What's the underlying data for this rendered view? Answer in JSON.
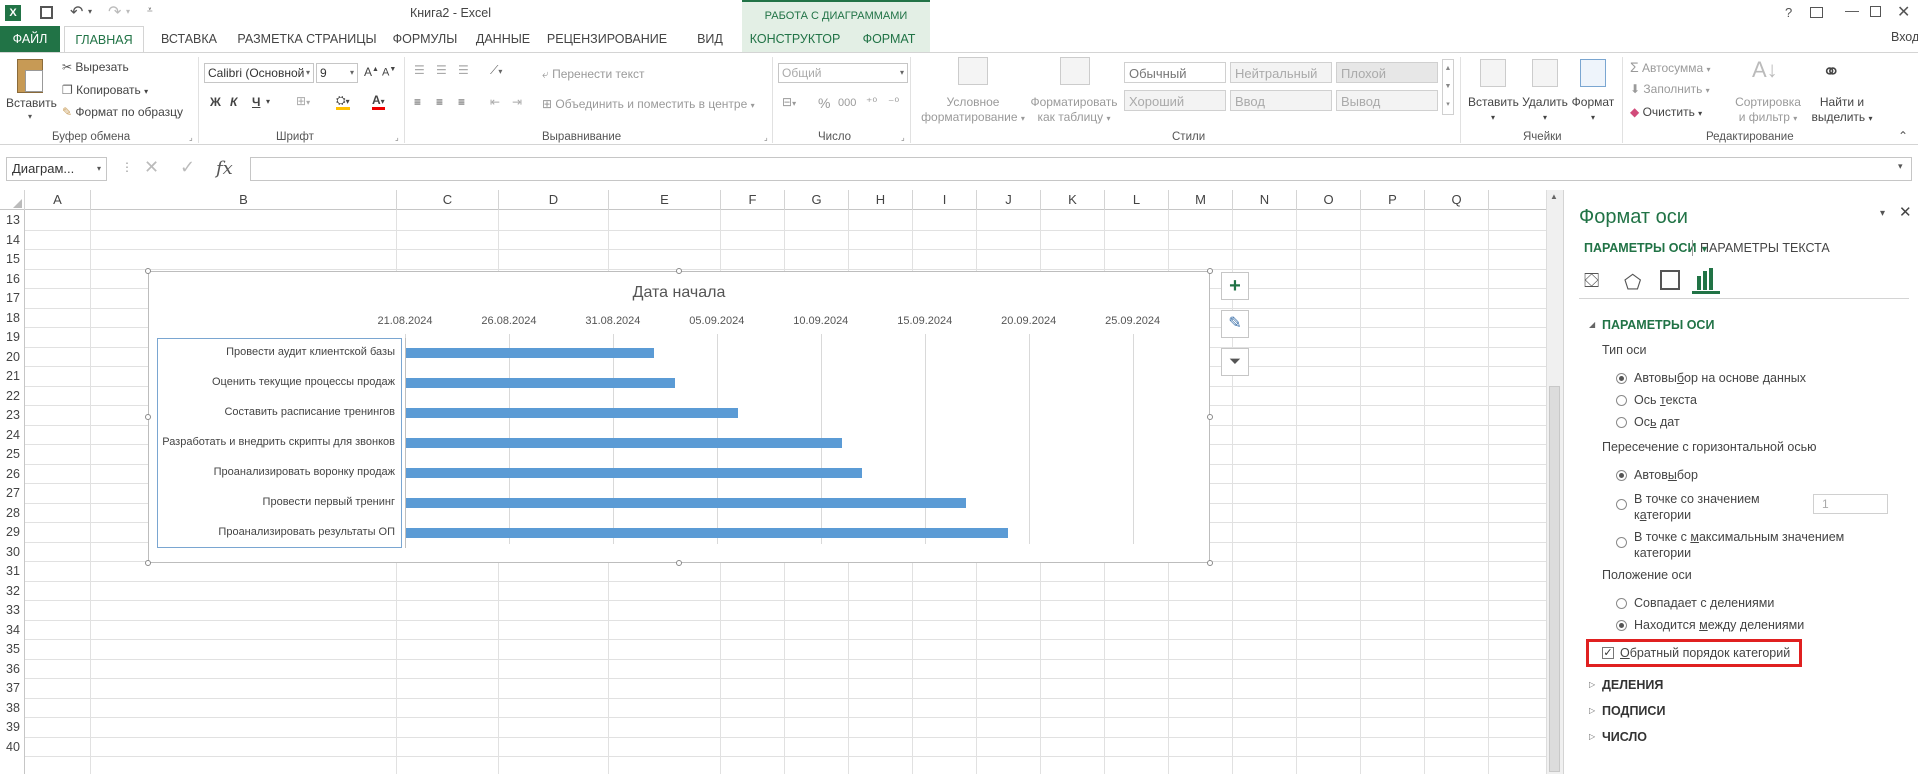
{
  "window": {
    "title": "Книга2 - Excel",
    "context_group": "РАБОТА С ДИАГРАММАМИ",
    "help": "?",
    "signin": "Вход"
  },
  "tabs": [
    "ФАЙЛ",
    "ГЛАВНАЯ",
    "ВСТАВКА",
    "РАЗМЕТКА СТРАНИЦЫ",
    "ФОРМУЛЫ",
    "ДАННЫЕ",
    "РЕЦЕНЗИРОВАНИЕ",
    "ВИД",
    "КОНСТРУКТОР",
    "ФОРМАТ"
  ],
  "ribbon": {
    "clipboard": {
      "label": "Буфер обмена",
      "paste": "Вставить",
      "cut": "Вырезать",
      "copy": "Копировать",
      "format_painter": "Формат по образцу"
    },
    "font": {
      "label": "Шрифт",
      "name": "Calibri (Основной",
      "size": "9",
      "bold": "Ж",
      "italic": "К",
      "underline": "Ч"
    },
    "alignment": {
      "label": "Выравнивание",
      "wrap": "Перенести текст",
      "merge": "Объединить и поместить в центре"
    },
    "number": {
      "label": "Число",
      "format": "Общий",
      "percent": "%",
      "thousands": "000"
    },
    "styles": {
      "label": "Стили",
      "cond_line1": "Условное",
      "cond_line2": "форматирование",
      "table_line1": "Форматировать",
      "table_line2": "как таблицу",
      "cells": [
        "Обычный",
        "Нейтральный",
        "Плохой",
        "Хороший",
        "Ввод",
        "Вывод"
      ]
    },
    "cells": {
      "label": "Ячейки",
      "insert": "Вставить",
      "delete": "Удалить",
      "format": "Формат"
    },
    "editing": {
      "label": "Редактирование",
      "autosum": "Автосумма",
      "fill": "Заполнить",
      "clear": "Очистить",
      "sort_line1": "Сортировка",
      "sort_line2": "и фильтр",
      "find_line1": "Найти и",
      "find_line2": "выделить"
    }
  },
  "formula_bar": {
    "name_box": "Диаграм...",
    "fx": "fx",
    "value": ""
  },
  "columns": [
    "A",
    "B",
    "C",
    "D",
    "E",
    "F",
    "G",
    "H",
    "I",
    "J",
    "K",
    "L",
    "M",
    "N",
    "O",
    "P",
    "Q",
    "R"
  ],
  "rows": [
    "13",
    "14",
    "15",
    "16",
    "17",
    "18",
    "19",
    "20",
    "21",
    "22",
    "23",
    "24",
    "25",
    "26",
    "27",
    "28",
    "29",
    "30",
    "31",
    "32",
    "33",
    "34",
    "35",
    "36",
    "37",
    "38",
    "39",
    "40"
  ],
  "chart_data": {
    "type": "bar",
    "title": "Дата начала",
    "x_ticks": [
      "21.08.2024",
      "26.08.2024",
      "31.08.2024",
      "05.09.2024",
      "10.09.2024",
      "15.09.2024",
      "20.09.2024",
      "25.09.2024"
    ],
    "xlim": [
      "21.08.2024",
      "28.09.2024"
    ],
    "categories": [
      "Провести аудит клиентской базы",
      "Оценить текущие процессы продаж",
      "Составить расписание тренингов",
      "Разработать и внедрить скрипты для звонков",
      "Проанализировать воронку продаж",
      "Провести первый тренинг",
      "Проанализировать результаты ОП"
    ],
    "values": [
      "02.09.2024",
      "03.09.2024",
      "06.09.2024",
      "11.09.2024",
      "12.09.2024",
      "17.09.2024",
      "19.09.2024"
    ],
    "color": "#5b9bd5",
    "grid": true
  },
  "pane": {
    "title": "Формат оси",
    "tab_axis": "ПАРАМЕТРЫ ОСИ",
    "tab_text": "ПАРАМЕТРЫ ТЕКСТА",
    "section_axis": "ПАРАМЕТРЫ ОСИ",
    "axis_type": "Тип оси",
    "axis_type_auto": [
      "Автовы",
      "б",
      "ор на основе данных"
    ],
    "axis_type_text": [
      "Ось ",
      "т",
      "екста"
    ],
    "axis_type_date": [
      "Ос",
      "ь",
      " дат"
    ],
    "crosses": "Пересечение с горизонтальной осью",
    "crosses_auto": [
      "Автов",
      "ы",
      "бор"
    ],
    "crosses_at_line1": "В точке со значением",
    "crosses_at_line2": [
      "к",
      "а",
      "тегории"
    ],
    "crosses_at_value": "1",
    "crosses_max_line1": [
      "В точке с ",
      "м",
      "аксимальным значением"
    ],
    "crosses_max_line2": "категории",
    "position": "Положение оси",
    "pos_on": [
      "Совпадает с ",
      "д",
      "елениями"
    ],
    "pos_between": [
      "Находится ",
      "м",
      "ежду делениями"
    ],
    "reverse": [
      "О",
      "братный порядок категорий"
    ],
    "sections": [
      "ДЕЛЕНИЯ",
      "ПОДПИСИ",
      "ЧИСЛО"
    ]
  }
}
